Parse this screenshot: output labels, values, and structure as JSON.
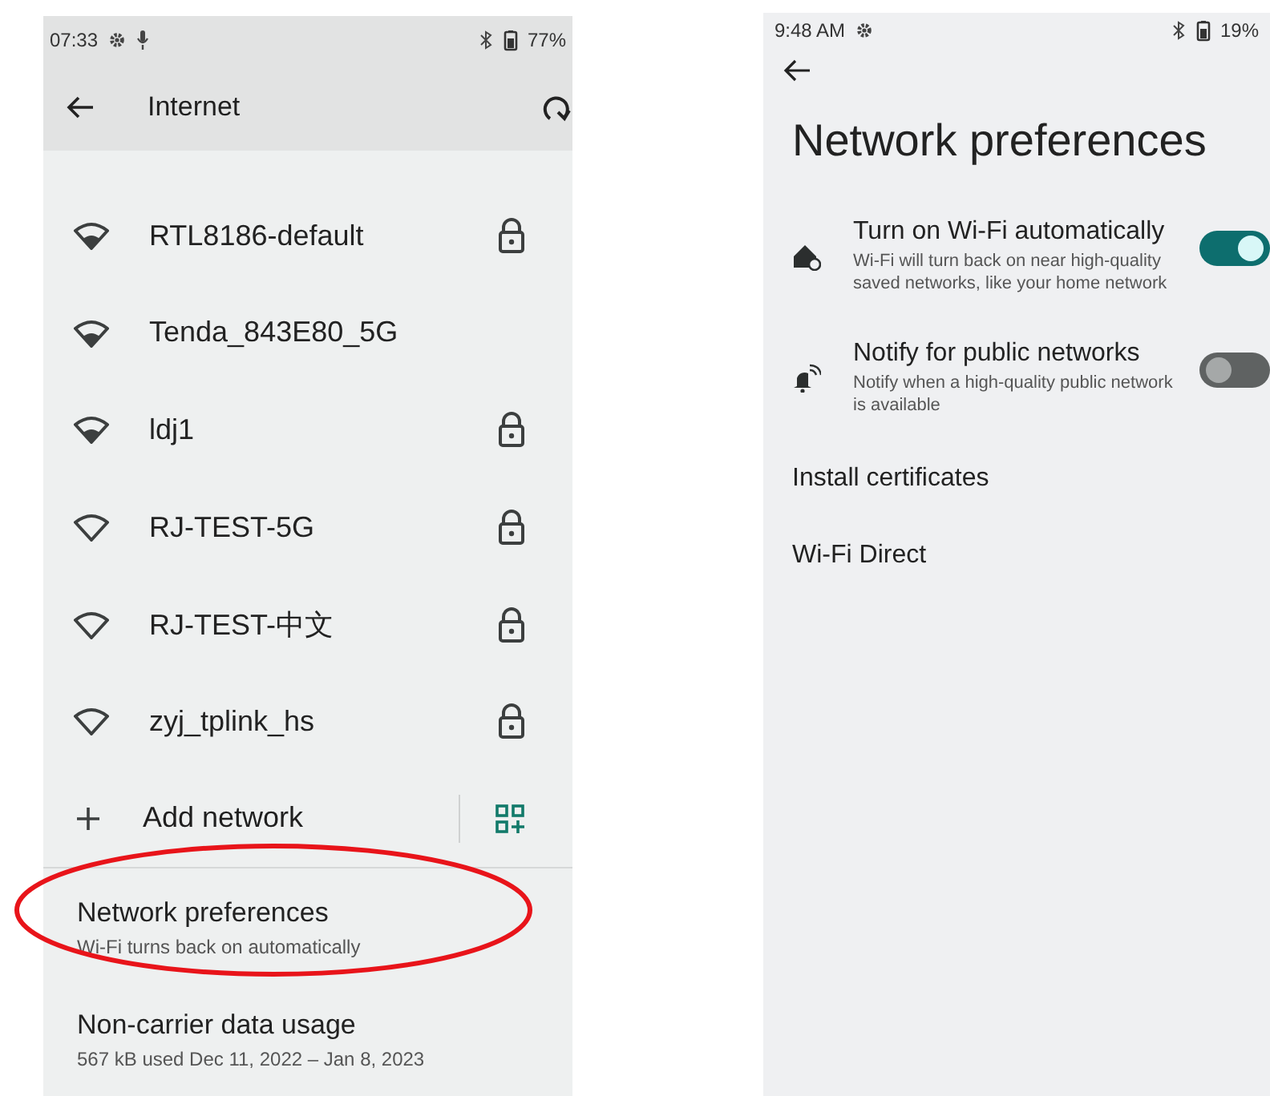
{
  "internet_screen": {
    "status_bar": {
      "time": "07:33",
      "battery": "77%"
    },
    "app_bar": {
      "title": "Internet"
    },
    "networks": [
      {
        "name": "RTL8186-default",
        "strong_signal": true,
        "secured": true
      },
      {
        "name": "Tenda_843E80_5G",
        "strong_signal": true,
        "secured": false
      },
      {
        "name": "ldj1",
        "strong_signal": true,
        "secured": true
      },
      {
        "name": "RJ-TEST-5G",
        "strong_signal": false,
        "secured": true
      },
      {
        "name": "RJ-TEST-中文",
        "strong_signal": false,
        "secured": true
      },
      {
        "name": "zyj_tplink_hs",
        "strong_signal": false,
        "secured": true
      }
    ],
    "add_network": {
      "label": "Add network"
    },
    "items": [
      {
        "title": "Network preferences",
        "summary": "Wi-Fi turns back on automatically",
        "circled": true
      },
      {
        "title": "Non-carrier data usage",
        "summary": "567 kB used Dec 11, 2022 – Jan 8, 2023",
        "circled": false
      }
    ]
  },
  "preferences_screen": {
    "status_bar": {
      "time": "9:48 AM",
      "battery": "19%"
    },
    "title": "Network preferences",
    "settings": [
      {
        "kind": "home",
        "title": "Turn on Wi-Fi automatically",
        "summary": "Wi-Fi will turn back on near high-quality saved networks, like your home network",
        "on": true
      },
      {
        "kind": "bell",
        "title": "Notify for public networks",
        "summary": "Notify when a high-quality public network is available",
        "on": false
      }
    ],
    "links": [
      {
        "label": "Install certificates"
      },
      {
        "label": "Wi-Fi Direct"
      }
    ]
  }
}
